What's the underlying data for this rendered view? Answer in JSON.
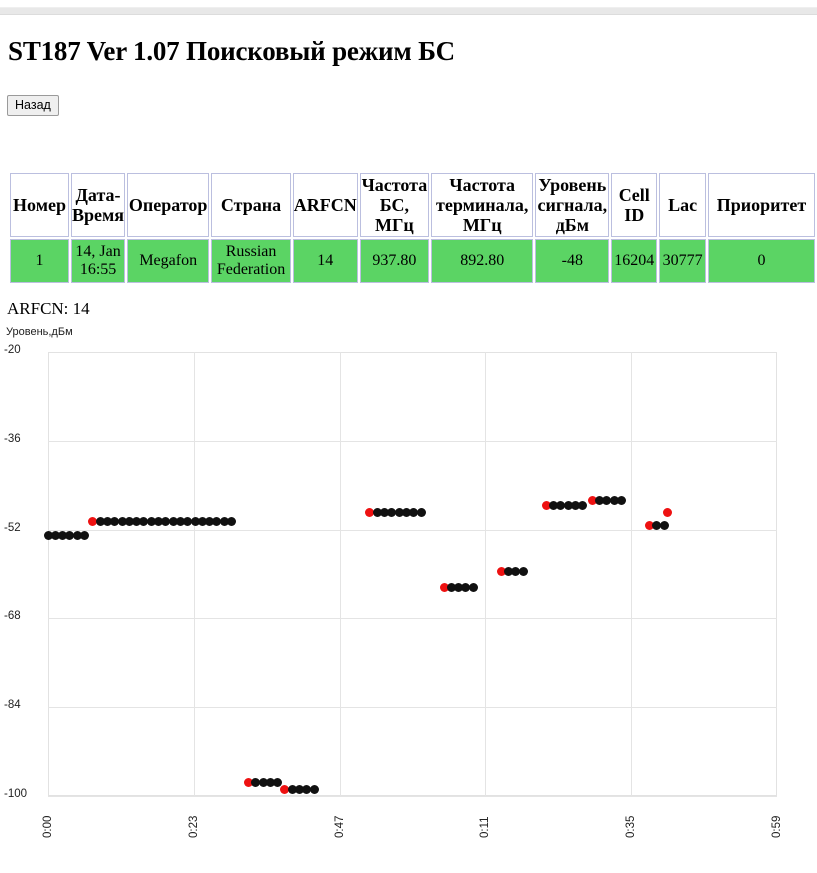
{
  "page": {
    "title": "ST187 Ver 1.07 Поисковый режим БС",
    "back_label": "Назад"
  },
  "table": {
    "headers": [
      "Номер",
      "Дата-Время",
      "Оператор",
      "Страна",
      "ARFCN",
      "Частота БС, МГц",
      "Частота терминала, МГц",
      "Уровень сигнала, дБм",
      "Cell ID",
      "Lac",
      "Приоритет"
    ],
    "header_lines": {
      "nomer": "Номер",
      "datetime_1": "Дата-",
      "datetime_2": "Время",
      "operator": "Оператор",
      "country": "Страна",
      "arfcn": "ARFCN",
      "freqbs_1": "Частота",
      "freqbs_2": "БС,",
      "freqbs_3": "МГц",
      "freqterm_1": "Частота",
      "freqterm_2": "терминала,",
      "freqterm_3": "МГц",
      "level_1": "Уровень",
      "level_2": "сигнала,",
      "level_3": "дБм",
      "cellid_1": "Cell",
      "cellid_2": "ID",
      "lac": "Lac",
      "prio": "Приоритет"
    },
    "rows": [
      {
        "nomer": "1",
        "datetime_1": "14, Jan",
        "datetime_2": "16:55",
        "operator": "Megafon",
        "country_1": "Russian",
        "country_2": "Federation",
        "arfcn": "14",
        "freq_bs": "937.80",
        "freq_term": "892.80",
        "level": "-48",
        "cell_id": "16204",
        "lac": "30777",
        "priority": "0"
      }
    ],
    "row_color": "#5bd464"
  },
  "chart_header": {
    "arfcn_label": "ARFCN: 14",
    "y_axis_title": "Уровень,дБм"
  },
  "chart_data": {
    "type": "scatter",
    "title": "ARFCN: 14",
    "xlabel": "",
    "ylabel": "Уровень,дБм",
    "ylim": [
      -100,
      -20
    ],
    "y_ticks": [
      -20,
      -36,
      -52,
      -68,
      -84,
      -100
    ],
    "x_ticks": [
      "0:00",
      "0:23",
      "0:47",
      "0:11",
      "0:35",
      "0:59"
    ],
    "grid": true,
    "legend": null,
    "series": [
      {
        "name": "Уровень сигнала",
        "marker_colors": {
          "start": "#ee1111",
          "run": "#111111"
        },
        "points": [
          {
            "x": 0.0,
            "y": -53.0,
            "color": "black"
          },
          {
            "x": 0.6,
            "y": -53.0,
            "color": "black"
          },
          {
            "x": 1.2,
            "y": -53.0,
            "color": "black"
          },
          {
            "x": 1.8,
            "y": -53.0,
            "color": "black"
          },
          {
            "x": 2.4,
            "y": -53.0,
            "color": "black"
          },
          {
            "x": 3.0,
            "y": -53.0,
            "color": "black"
          },
          {
            "x": 3.7,
            "y": -50.5,
            "color": "red"
          },
          {
            "x": 4.3,
            "y": -50.5,
            "color": "black"
          },
          {
            "x": 4.9,
            "y": -50.5,
            "color": "black"
          },
          {
            "x": 5.5,
            "y": -50.5,
            "color": "black"
          },
          {
            "x": 6.1,
            "y": -50.5,
            "color": "black"
          },
          {
            "x": 6.7,
            "y": -50.5,
            "color": "black"
          },
          {
            "x": 7.3,
            "y": -50.5,
            "color": "black"
          },
          {
            "x": 7.9,
            "y": -50.5,
            "color": "black"
          },
          {
            "x": 8.5,
            "y": -50.5,
            "color": "black"
          },
          {
            "x": 9.1,
            "y": -50.5,
            "color": "black"
          },
          {
            "x": 9.7,
            "y": -50.5,
            "color": "black"
          },
          {
            "x": 10.3,
            "y": -50.5,
            "color": "black"
          },
          {
            "x": 10.9,
            "y": -50.5,
            "color": "black"
          },
          {
            "x": 11.5,
            "y": -50.5,
            "color": "black"
          },
          {
            "x": 12.1,
            "y": -50.5,
            "color": "black"
          },
          {
            "x": 12.7,
            "y": -50.5,
            "color": "black"
          },
          {
            "x": 13.3,
            "y": -50.5,
            "color": "black"
          },
          {
            "x": 13.9,
            "y": -50.5,
            "color": "black"
          },
          {
            "x": 14.5,
            "y": -50.5,
            "color": "black"
          },
          {
            "x": 15.1,
            "y": -50.5,
            "color": "black"
          },
          {
            "x": 16.5,
            "y": -97.5,
            "color": "red"
          },
          {
            "x": 17.1,
            "y": -97.5,
            "color": "black"
          },
          {
            "x": 17.7,
            "y": -97.5,
            "color": "black"
          },
          {
            "x": 18.3,
            "y": -97.5,
            "color": "black"
          },
          {
            "x": 18.9,
            "y": -97.5,
            "color": "black"
          },
          {
            "x": 19.5,
            "y": -98.8,
            "color": "red"
          },
          {
            "x": 20.1,
            "y": -98.8,
            "color": "black"
          },
          {
            "x": 20.7,
            "y": -98.8,
            "color": "black"
          },
          {
            "x": 21.3,
            "y": -98.8,
            "color": "black"
          },
          {
            "x": 21.9,
            "y": -98.8,
            "color": "black"
          },
          {
            "x": 26.5,
            "y": -48.9,
            "color": "red"
          },
          {
            "x": 27.1,
            "y": -48.9,
            "color": "black"
          },
          {
            "x": 27.7,
            "y": -48.9,
            "color": "black"
          },
          {
            "x": 28.3,
            "y": -48.9,
            "color": "black"
          },
          {
            "x": 28.9,
            "y": -48.9,
            "color": "black"
          },
          {
            "x": 29.5,
            "y": -48.9,
            "color": "black"
          },
          {
            "x": 30.1,
            "y": -48.9,
            "color": "black"
          },
          {
            "x": 30.7,
            "y": -48.9,
            "color": "black"
          },
          {
            "x": 32.6,
            "y": -62.5,
            "color": "red"
          },
          {
            "x": 33.2,
            "y": -62.5,
            "color": "black"
          },
          {
            "x": 33.8,
            "y": -62.5,
            "color": "black"
          },
          {
            "x": 34.4,
            "y": -62.5,
            "color": "black"
          },
          {
            "x": 35.0,
            "y": -62.5,
            "color": "black"
          },
          {
            "x": 37.3,
            "y": -59.5,
            "color": "red"
          },
          {
            "x": 37.9,
            "y": -59.5,
            "color": "black"
          },
          {
            "x": 38.5,
            "y": -59.5,
            "color": "black"
          },
          {
            "x": 39.1,
            "y": -59.5,
            "color": "black"
          },
          {
            "x": 41.0,
            "y": -47.7,
            "color": "red"
          },
          {
            "x": 41.6,
            "y": -47.7,
            "color": "black"
          },
          {
            "x": 42.2,
            "y": -47.7,
            "color": "black"
          },
          {
            "x": 42.8,
            "y": -47.7,
            "color": "black"
          },
          {
            "x": 43.4,
            "y": -47.7,
            "color": "black"
          },
          {
            "x": 44.0,
            "y": -47.7,
            "color": "black"
          },
          {
            "x": 44.8,
            "y": -46.8,
            "color": "red"
          },
          {
            "x": 45.4,
            "y": -46.8,
            "color": "black"
          },
          {
            "x": 46.0,
            "y": -46.8,
            "color": "black"
          },
          {
            "x": 46.6,
            "y": -46.8,
            "color": "black"
          },
          {
            "x": 47.2,
            "y": -46.8,
            "color": "black"
          },
          {
            "x": 49.5,
            "y": -51.3,
            "color": "red"
          },
          {
            "x": 50.1,
            "y": -51.3,
            "color": "black"
          },
          {
            "x": 50.7,
            "y": -51.3,
            "color": "black"
          },
          {
            "x": 51.0,
            "y": -49.0,
            "color": "red"
          }
        ]
      }
    ]
  }
}
